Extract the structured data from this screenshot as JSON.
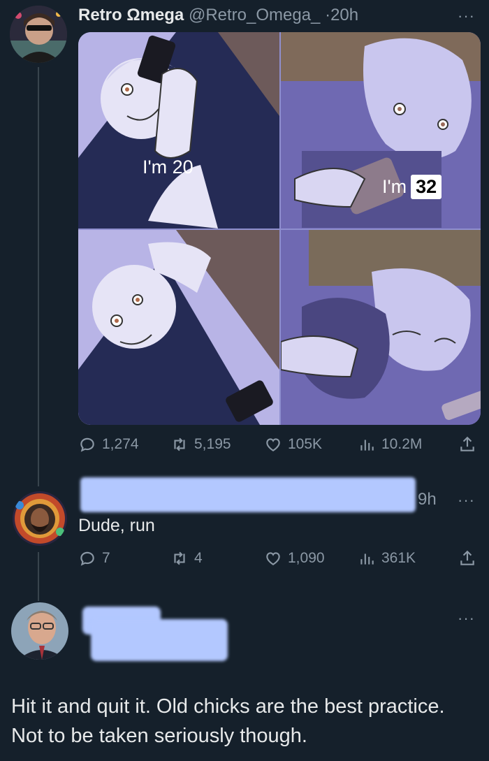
{
  "tweet": {
    "author_name": "Retro Ωmega",
    "handle": "@Retro_Omega_",
    "time": "·20h",
    "more": "···",
    "media": {
      "caption_top": "I'm 20",
      "caption_bottom_prefix": "I'm",
      "caption_bottom_number": "32"
    },
    "actions": {
      "replies": "1,274",
      "retweets": "5,195",
      "likes": "105K",
      "views": "10.2M"
    }
  },
  "reply1": {
    "time": "9h",
    "more": "···",
    "text": "Dude, run",
    "actions": {
      "replies": "7",
      "retweets": "4",
      "likes": "1,090",
      "views": "361K"
    }
  },
  "reply2": {
    "more": "···",
    "text": "Hit it and quit it. Old chicks are the best practice. Not to be taken seriously though."
  },
  "colors": {
    "background": "#15202b",
    "muted": "#8b98a5",
    "redaction": "#b3c8ff"
  }
}
